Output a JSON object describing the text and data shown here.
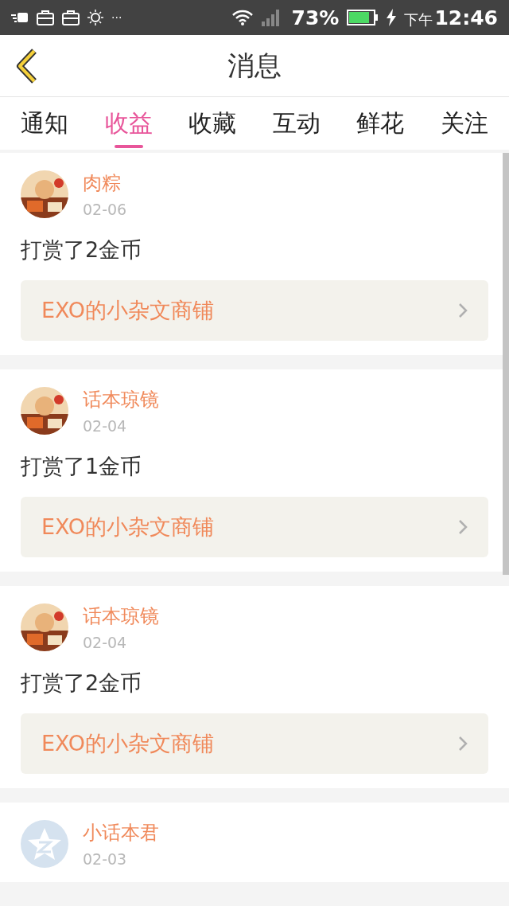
{
  "status_bar": {
    "battery": "73%",
    "period": "下午",
    "time": "12:46",
    "more": "···"
  },
  "header": {
    "title": "消息"
  },
  "tabs": [
    {
      "label": "通知",
      "selected": false
    },
    {
      "label": "收益",
      "selected": true
    },
    {
      "label": "收藏",
      "selected": false
    },
    {
      "label": "互动",
      "selected": false
    },
    {
      "label": "鲜花",
      "selected": false
    },
    {
      "label": "关注",
      "selected": false
    }
  ],
  "messages": [
    {
      "kind": "picture",
      "name": "肉粽",
      "date": "02-06",
      "action": "打赏了2金币",
      "link": "EXO的小杂文商铺"
    },
    {
      "kind": "picture",
      "name": "话本琼镜",
      "date": "02-04",
      "action": "打赏了1金币",
      "link": "EXO的小杂文商铺"
    },
    {
      "kind": "picture",
      "name": "话本琼镜",
      "date": "02-04",
      "action": "打赏了2金币",
      "link": "EXO的小杂文商铺"
    },
    {
      "kind": "icon",
      "name": "小话本君",
      "date": "02-03"
    }
  ]
}
